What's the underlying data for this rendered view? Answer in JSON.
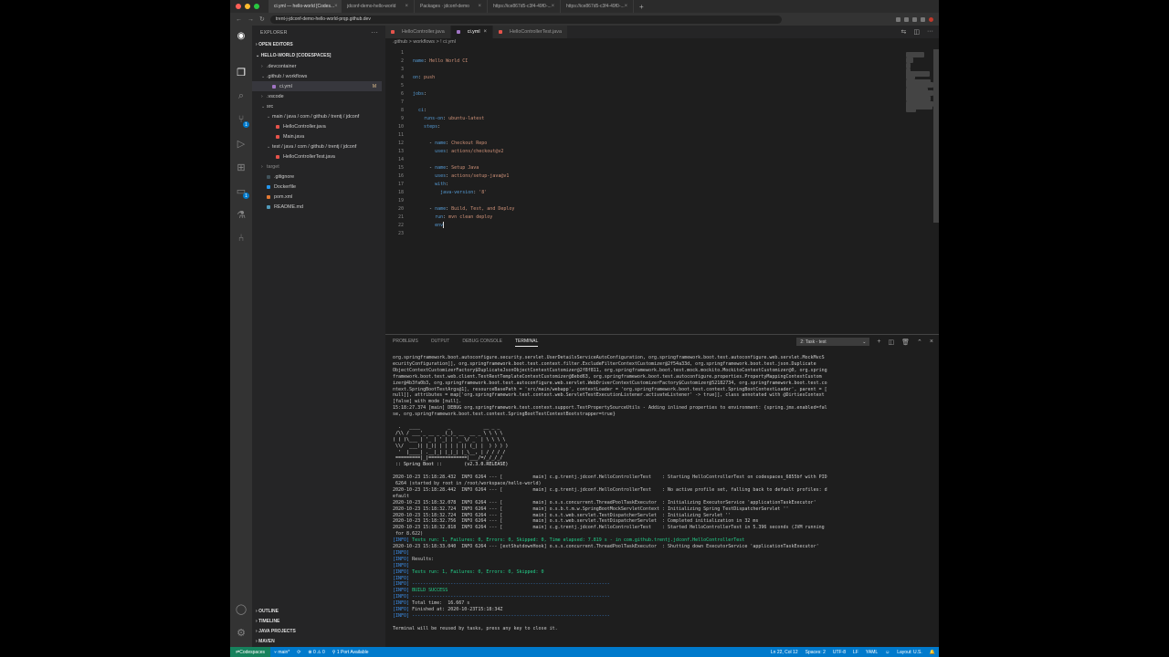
{
  "browser": {
    "tabs": [
      "ci.yml — hello-world [Codes...",
      "jdconf-demo-hello-world",
      "Packages · jdconf-demo",
      "https://ice867d5-c3f4-49f0-...",
      "https://ice867d5-c3f4-49f0-..."
    ],
    "url": "trent-j-jdconf-demo-hello-world-prqp.github.dev"
  },
  "sidebar": {
    "title": "EXPLORER",
    "open_editors": "OPEN EDITORS",
    "workspace": "HELLO-WORLD [CODESPACES]",
    "items": [
      {
        "label": ".devcontainer",
        "depth": 1,
        "type": "folder"
      },
      {
        "label": ".github / workflows",
        "depth": 1,
        "type": "folder"
      },
      {
        "label": "ci.yml",
        "depth": 2,
        "type": "file",
        "marker": "M"
      },
      {
        "label": ".vscode",
        "depth": 1,
        "type": "folder"
      },
      {
        "label": "src",
        "depth": 1,
        "type": "folder"
      },
      {
        "label": "main / java / com / github / trentj / jdconf",
        "depth": 2,
        "type": "folder"
      },
      {
        "label": "HelloController.java",
        "depth": 3,
        "type": "java"
      },
      {
        "label": "Main.java",
        "depth": 3,
        "type": "java"
      },
      {
        "label": "test / java / com / github / trentj / jdconf",
        "depth": 2,
        "type": "folder"
      },
      {
        "label": "HelloControllerTest.java",
        "depth": 3,
        "type": "java"
      },
      {
        "label": "target",
        "depth": 1,
        "type": "folder"
      },
      {
        "label": ".gitignore",
        "depth": 1,
        "type": "file"
      },
      {
        "label": "Dockerfile",
        "depth": 1,
        "type": "file"
      },
      {
        "label": "pom.xml",
        "depth": 1,
        "type": "file"
      },
      {
        "label": "README.md",
        "depth": 1,
        "type": "file"
      }
    ],
    "bottom_sections": [
      "OUTLINE",
      "TIMELINE",
      "JAVA PROJECTS",
      "MAVEN"
    ]
  },
  "editor": {
    "tabs": [
      {
        "label": "HelloController.java",
        "active": false
      },
      {
        "label": "ci.yml",
        "active": true
      },
      {
        "label": "HelloControllerTest.java",
        "active": false
      }
    ],
    "breadcrumb": ".github > workflows > ! ci.yml",
    "lines": [
      "",
      "name: Hello World CI",
      "",
      "on: push",
      "",
      "jobs:",
      "",
      "  ci:",
      "    runs-on: ubuntu-latest",
      "    steps:",
      "",
      "      - name: Checkout Repo",
      "        uses: actions/checkout@v2",
      "",
      "      - name: Setup Java",
      "        uses: actions/setup-java@v1",
      "        with:",
      "          java-version: '8'",
      "",
      "      - name: Build, Test, and Deploy",
      "        run: mvn clean deploy",
      "        env",
      ""
    ]
  },
  "panel": {
    "tabs": [
      "PROBLEMS",
      "OUTPUT",
      "DEBUG CONSOLE",
      "TERMINAL"
    ],
    "active_tab": "TERMINAL",
    "terminal_select": "2: Task - test",
    "terminal_lines": [
      "org.springframework.boot.autoconfigure.security.servlet.UserDetailsServiceAutoConfiguration, org.springframework.boot.test.autoconfigure.web.servlet.MockMvcS",
      "ecurityConfiguration]], org.springframework.boot.test.context.filter.ExcludeFilterContextCustomizer@2f54a33d, org.springframework.boot.test.json.Duplicate",
      "ObjectContextCustomizerFactory$DuplicateJsonObjectContextCustomizer@2f8f811, org.springframework.boot.test.mock.mockito.MockitoContextCustomizer@0, org.spring",
      "framework.boot.test.web.client.TestRestTemplateContextCustomizer@8ebd63, org.springframework.boot.test.autoconfigure.properties.PropertyMappingContextCustom",
      "izer@4b3fa0b3, org.springframework.boot.test.autoconfigure.web.servlet.WebDriverContextCustomizerFactory$Customizer@52182734, org.springframework.boot.test.co",
      "ntext.SpringBootTestArgs@1], resourceBasePath = 'src/main/webapp', contextLoader = 'org.springframework.boot.test.context.SpringBootContextLoader', parent = [",
      "null]], attributes = map['org.springframework.test.context.web.ServletTestExecutionListener.activateListener' -> true]], class annotated with @DirtiesContext",
      "[false] with mode [null].",
      "15:18:27.374 [main] DEBUG org.springframework.test.context.support.TestPropertySourceUtils - Adding inlined properties to environment: {spring.jmx.enabled=fal",
      "se, org.springframework.boot.test.context.SpringBootTestContextBootstrapper=true}",
      "",
      "  .   ____          _            __ _ _",
      " /\\\\ / ___'_ __ _ _(_)_ __  __ _ \\ \\ \\ \\",
      "( ( )\\___ | '_ | '_| | '_ \\/ _` | \\ \\ \\ \\",
      " \\\\/  ___)| |_)| | | | | || (_| |  ) ) ) )",
      "  '  |____| .__|_| |_|_| |_\\__, | / / / /",
      " =========|_|==============|___/=/_/_/_/",
      " :: Spring Boot ::        (v2.3.0.RELEASE)",
      "",
      "2020-10-23 15:18:28.432  INFO 6264 --- [           main] c.g.trentj.jdconf.HelloControllerTest    : Starting HelloControllerTest on codespaces_6855bf with PID",
      " 6264 (started by root in /root/workspace/hello-world)",
      "2020-10-23 15:18:28.442  INFO 6264 --- [           main] c.g.trentj.jdconf.HelloControllerTest    : No active profile set, falling back to default profiles: d",
      "efault",
      "2020-10-23 15:18:32.078  INFO 6264 --- [           main] o.s.s.concurrent.ThreadPoolTaskExecutor  : Initializing ExecutorService 'applicationTaskExecutor'",
      "2020-10-23 15:18:32.724  INFO 6264 --- [           main] o.s.b.t.m.w.SpringBootMockServletContext : Initializing Spring TestDispatcherServlet ''",
      "2020-10-23 15:18:32.724  INFO 6264 --- [           main] o.s.t.web.servlet.TestDispatcherServlet  : Initializing Servlet ''",
      "2020-10-23 15:18:32.756  INFO 6264 --- [           main] o.s.t.web.servlet.TestDispatcherServlet  : Completed initialization in 32 ms",
      "2020-10-23 15:18:32.818  INFO 6264 --- [           main] c.g.trentj.jdconf.HelloControllerTest    : Started HelloControllerTest in 5.396 seconds (JVM running",
      " for 8.622)",
      "[INFO] Tests run: 1, Failures: 0, Errors: 0, Skipped: 0, Time elapsed: 7.819 s - in com.github.trentj.jdconf.HelloControllerTest",
      "2020-10-23 15:18:33.040  INFO 6264 --- [extShutdownHook] o.s.s.concurrent.ThreadPoolTaskExecutor  : Shutting down ExecutorService 'applicationTaskExecutor'",
      "[INFO]",
      "[INFO] Results:",
      "[INFO]",
      "[INFO] Tests run: 1, Failures: 0, Errors: 0, Skipped: 0",
      "[INFO]",
      "[INFO] ------------------------------------------------------------------------",
      "[INFO] BUILD SUCCESS",
      "[INFO] ------------------------------------------------------------------------",
      "[INFO] Total time:  16.667 s",
      "[INFO] Finished at: 2020-10-23T15:18:34Z",
      "[INFO] ------------------------------------------------------------------------",
      "",
      "Terminal will be reused by tasks, press any key to close it.",
      ""
    ]
  },
  "statusbar": {
    "remote": "Codespaces",
    "branch": "main*",
    "sync": "⟳",
    "problems": "⊗ 0 ⚠ 0",
    "ports": "1 Port Available",
    "cursor": "Ln 22, Col 12",
    "indent": "Spaces: 2",
    "encoding": "UTF-8",
    "eol": "LF",
    "language": "YAML",
    "layout": "Layout: U.S."
  },
  "colors": {
    "accent": "#007acc",
    "remote": "#16825d",
    "yaml_key": "#569cd6",
    "yaml_string": "#ce9178"
  }
}
